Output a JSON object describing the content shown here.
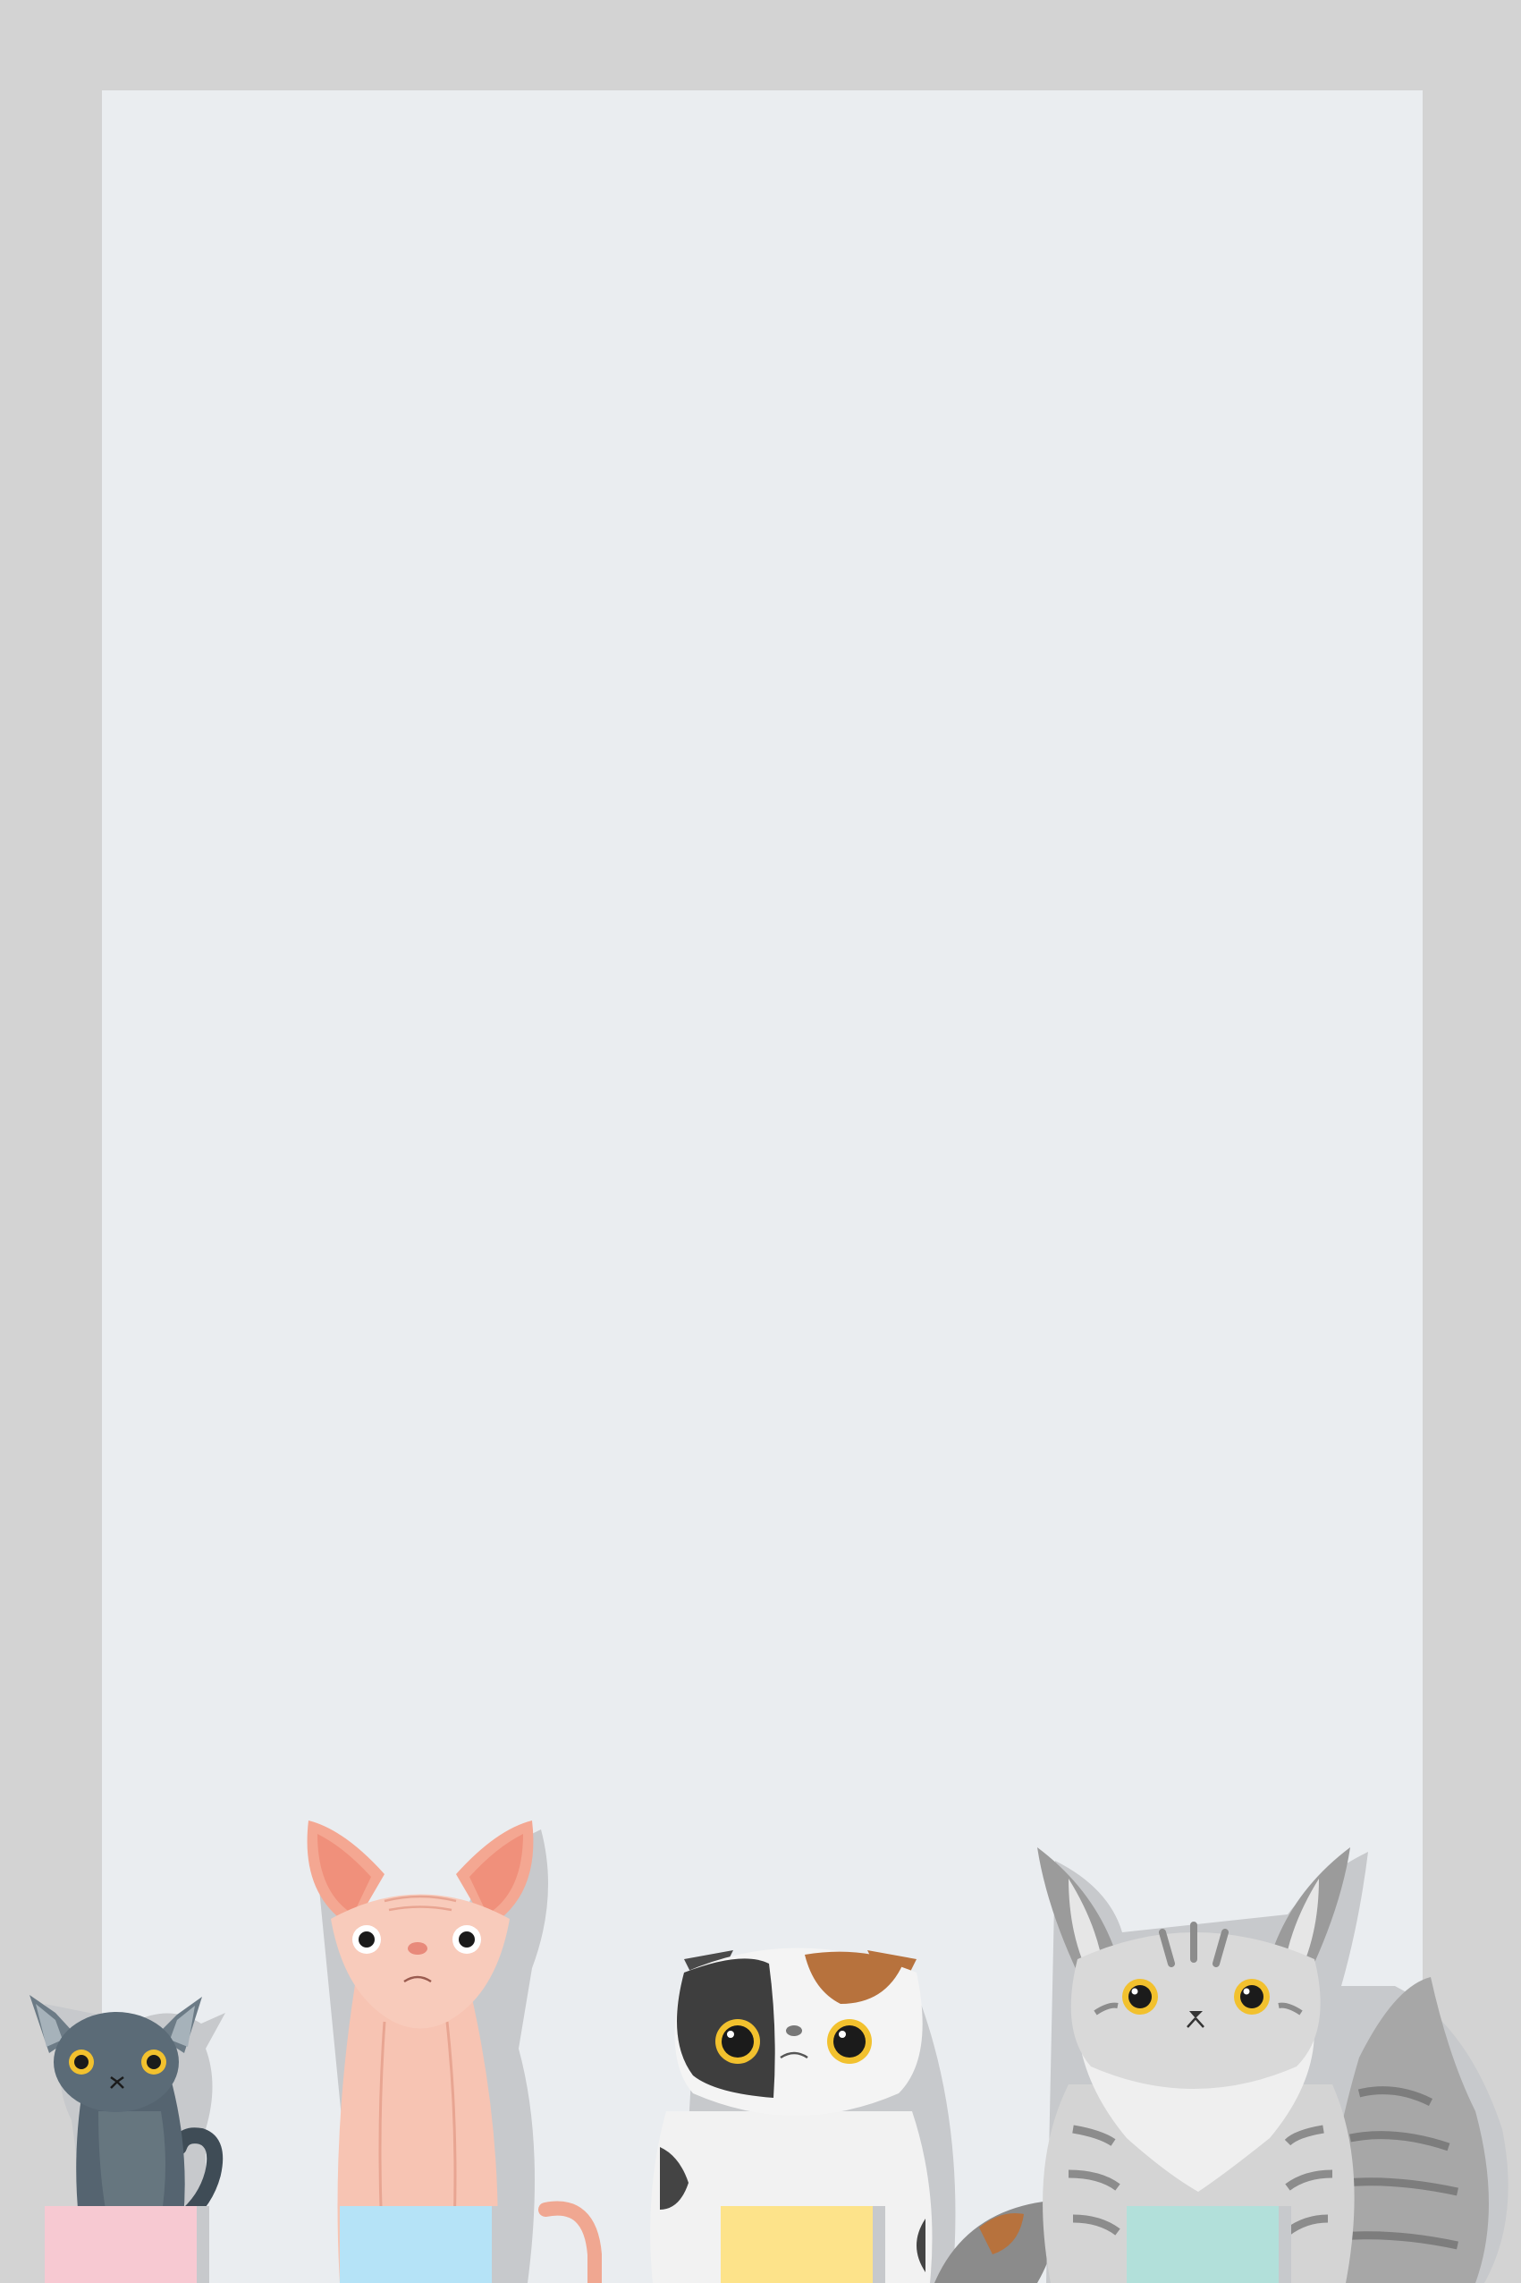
{
  "page": {
    "outer_bg": "#d3d3d3",
    "panel_bg": "#eaedf0"
  },
  "cats": [
    {
      "name": "gray-cat",
      "body_color": "#5b6b77",
      "eye_color": "#f2c12e",
      "tag_color": "#f7c9d2"
    },
    {
      "name": "sphynx-cat",
      "body_color": "#f8c6b5",
      "eye_color": "#ffffff",
      "tag_color": "#b5e3f7"
    },
    {
      "name": "calico-cat",
      "body_color": "#f2f2f2",
      "eye_color": "#f2c12e",
      "tag_color": "#fde38a"
    },
    {
      "name": "tabby-cat",
      "body_color": "#d7d7d7",
      "eye_color": "#f2c12e",
      "tag_color": "#b2e0da"
    }
  ]
}
